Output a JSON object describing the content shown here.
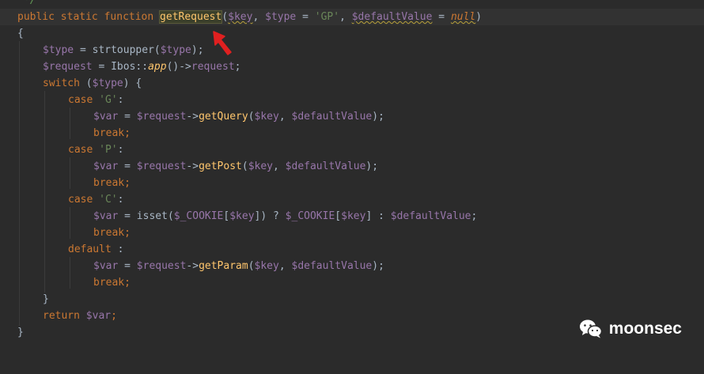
{
  "editor": {
    "comment_end": "*/",
    "signature": {
      "kw_public": "public",
      "kw_static": "static",
      "kw_function": "function",
      "fn_name": "getRequest",
      "open_paren": "(",
      "p1": "$key",
      "comma1": ", ",
      "p2": "$type",
      "eq1": " = ",
      "p2_default": "'GP'",
      "comma2": ", ",
      "p3": "$defaultValue",
      "eq2": " = ",
      "p3_default": "null",
      "close_paren": ")"
    },
    "open_brace": "{",
    "l3": {
      "var": "$type",
      "eq": " = ",
      "fn": "strtoupper",
      "open": "(",
      "arg": "$type",
      "close": ");"
    },
    "l4": {
      "var": "$request",
      "eq": " = Ibos::",
      "m": "app",
      "mid": "()->",
      "prop": "request",
      "end": ";"
    },
    "l5": {
      "kw": "switch",
      "mid": " (",
      "var": "$type",
      "end": ") {"
    },
    "case_g": {
      "kw": "case",
      "sp": " ",
      "str": "'G'",
      "colon": ":"
    },
    "g_stmt": {
      "var": "$var",
      "eq": " = ",
      "obj": "$request",
      "arrow": "->",
      "method": "getQuery",
      "open": "(",
      "a1": "$key",
      "comma": ", ",
      "a2": "$defaultValue",
      "close": ");"
    },
    "break": "break;",
    "case_p": {
      "kw": "case",
      "sp": " ",
      "str": "'P'",
      "colon": ":"
    },
    "p_stmt": {
      "var": "$var",
      "eq": " = ",
      "obj": "$request",
      "arrow": "->",
      "method": "getPost",
      "open": "(",
      "a1": "$key",
      "comma": ", ",
      "a2": "$defaultValue",
      "close": ");"
    },
    "case_c": {
      "kw": "case",
      "sp": " ",
      "str": "'C'",
      "colon": ":"
    },
    "c_stmt": {
      "var": "$var",
      "eq": " = ",
      "fn": "isset",
      "open": "(",
      "ck1": "$_COOKIE",
      "br1": "[",
      "k1": "$key",
      "br1c": "])",
      "tern": " ? ",
      "ck2": "$_COOKIE",
      "br2": "[",
      "k2": "$key",
      "br2c": "]",
      "colon": " : ",
      "dv": "$defaultValue",
      "end": ";"
    },
    "default_case": {
      "kw": "default",
      "colon": " :"
    },
    "d_stmt": {
      "var": "$var",
      "eq": " = ",
      "obj": "$request",
      "arrow": "->",
      "method": "getParam",
      "open": "(",
      "a1": "$key",
      "comma": ", ",
      "a2": "$defaultValue",
      "close": ");"
    },
    "close_switch": "}",
    "ret": {
      "kw": "return",
      "sp": " ",
      "var": "$var",
      "end": ";"
    },
    "close_fn": "}"
  },
  "watermark": {
    "text": "moonsec",
    "icon": "wechat-icon"
  },
  "colors": {
    "background": "#2b2b2b",
    "keyword": "#cc7832",
    "function": "#ffc66d",
    "variable": "#9876aa",
    "string": "#6a8759",
    "plain": "#a9b7c6",
    "arrow": "#e02020"
  }
}
